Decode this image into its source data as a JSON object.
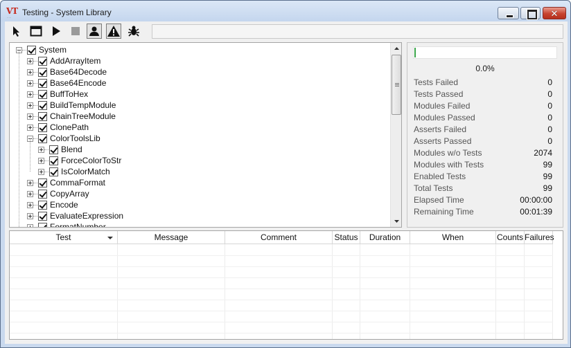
{
  "window": {
    "title": "Testing - System Library",
    "logo_text": "VT"
  },
  "toolbar": {
    "buttons": [
      {
        "name": "select-pointer",
        "icon": "cursor-arrow-icon"
      },
      {
        "name": "window",
        "icon": "window-icon"
      },
      {
        "name": "run",
        "icon": "play-icon"
      },
      {
        "name": "stop",
        "icon": "stop-icon"
      },
      {
        "name": "users",
        "icon": "user-icon",
        "toggled": true
      },
      {
        "name": "warnings",
        "icon": "warning-icon",
        "toggled": true
      },
      {
        "name": "debug",
        "icon": "bug-icon"
      }
    ],
    "status_text": ""
  },
  "tree": {
    "items": [
      {
        "label": "System",
        "level": 0,
        "expander": "minus",
        "checked": true
      },
      {
        "label": "AddArrayItem",
        "level": 1,
        "expander": "plus",
        "checked": true
      },
      {
        "label": "Base64Decode",
        "level": 1,
        "expander": "plus",
        "checked": true
      },
      {
        "label": "Base64Encode",
        "level": 1,
        "expander": "plus",
        "checked": true
      },
      {
        "label": "BuffToHex",
        "level": 1,
        "expander": "plus",
        "checked": true
      },
      {
        "label": "BuildTempModule",
        "level": 1,
        "expander": "plus",
        "checked": true
      },
      {
        "label": "ChainTreeModule",
        "level": 1,
        "expander": "plus",
        "checked": true
      },
      {
        "label": "ClonePath",
        "level": 1,
        "expander": "plus",
        "checked": true
      },
      {
        "label": "ColorToolsLib",
        "level": 1,
        "expander": "minus",
        "checked": true
      },
      {
        "label": "Blend",
        "level": 2,
        "expander": "plus",
        "checked": true
      },
      {
        "label": "ForceColorToStr",
        "level": 2,
        "expander": "plus",
        "checked": true
      },
      {
        "label": "IsColorMatch",
        "level": 2,
        "expander": "plus",
        "checked": true
      },
      {
        "label": "CommaFormat",
        "level": 1,
        "expander": "plus",
        "checked": true
      },
      {
        "label": "CopyArray",
        "level": 1,
        "expander": "plus",
        "checked": true
      },
      {
        "label": "Encode",
        "level": 1,
        "expander": "plus",
        "checked": true
      },
      {
        "label": "EvaluateExpression",
        "level": 1,
        "expander": "plus",
        "checked": true
      },
      {
        "label": "FormatNumber",
        "level": 1,
        "expander": "plus",
        "checked": true
      }
    ]
  },
  "stats": {
    "progress": 0.0,
    "progress_text": "0.0%",
    "rows": [
      {
        "label": "Tests Failed",
        "value": "0"
      },
      {
        "label": "Tests Passed",
        "value": "0"
      },
      {
        "label": "Modules Failed",
        "value": "0"
      },
      {
        "label": "Modules Passed",
        "value": "0"
      },
      {
        "label": "Asserts Failed",
        "value": "0"
      },
      {
        "label": "Asserts Passed",
        "value": "0"
      },
      {
        "label": "Modules w/o Tests",
        "value": "2074"
      },
      {
        "label": "Modules with Tests",
        "value": "99"
      },
      {
        "label": "Enabled Tests",
        "value": "99"
      },
      {
        "label": "Total Tests",
        "value": "99"
      },
      {
        "label": "Elapsed Time",
        "value": "00:00:00"
      },
      {
        "label": "Remaining Time",
        "value": "00:01:39"
      }
    ]
  },
  "results_grid": {
    "columns": [
      "Test",
      "Message",
      "Comment",
      "Status",
      "Duration",
      "When",
      "Counts",
      "Failures"
    ],
    "rows": []
  },
  "colors": {
    "progress_fill": "#3aa64a",
    "close_button": "#c7432f",
    "logo": "#c62a1e"
  }
}
